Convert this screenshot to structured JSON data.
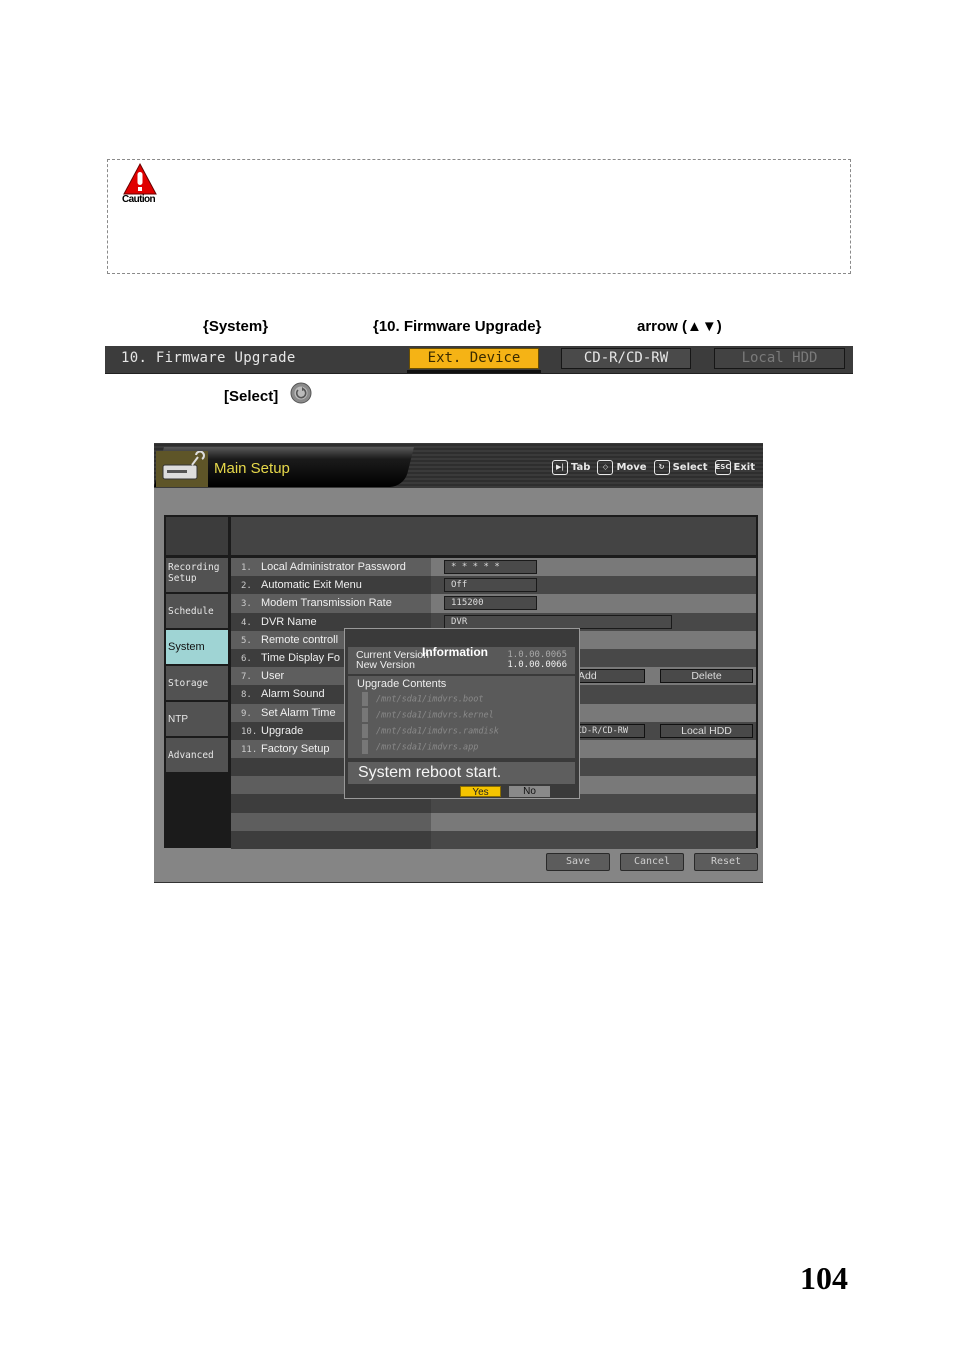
{
  "caution": {
    "label": "Caution",
    "icon": "warning-triangle-icon",
    "color": "#e00000"
  },
  "instruction": {
    "system": "{System}",
    "menu_item": "{10. Firmware Upgrade}",
    "arrow": "arrow (▲▼)",
    "select": "[Select]",
    "select_icon": "select-button-icon"
  },
  "firmware_bar": {
    "title": "10. Firmware Upgrade",
    "options": [
      {
        "label": "Ext. Device",
        "state": "active"
      },
      {
        "label": "CD-R/CD-RW",
        "state": "normal"
      },
      {
        "label": "Local HDD",
        "state": "disabled"
      }
    ],
    "accent": "#f5b315"
  },
  "screen": {
    "header": {
      "title": "Main Setup",
      "hints": [
        {
          "icon": "tab-icon",
          "glyph": "▶|",
          "label": "Tab"
        },
        {
          "icon": "move-icon",
          "glyph": "◇",
          "label": "Move"
        },
        {
          "icon": "select-icon",
          "glyph": "↻",
          "label": "Select"
        },
        {
          "icon": "esc-icon",
          "glyph": "ESC",
          "label": "Exit"
        }
      ]
    },
    "sidebar": [
      {
        "label": "Recording Setup",
        "selected": false
      },
      {
        "label": "Schedule",
        "selected": false
      },
      {
        "label": "System",
        "selected": true
      },
      {
        "label": "Storage",
        "selected": false
      },
      {
        "label": "NTP",
        "selected": false
      },
      {
        "label": "Advanced",
        "selected": false
      }
    ],
    "rows": [
      {
        "num": "1.",
        "label": "Local Administrator Password",
        "value": "* * * * *"
      },
      {
        "num": "2.",
        "label": "Automatic Exit Menu",
        "value": "Off"
      },
      {
        "num": "3.",
        "label": "Modem Transmission Rate",
        "value": "115200"
      },
      {
        "num": "4.",
        "label": "DVR Name",
        "value": "DVR"
      },
      {
        "num": "5.",
        "label": "Remote controll",
        "value": ""
      },
      {
        "num": "6.",
        "label": "Time Display Fo",
        "value": ""
      },
      {
        "num": "7.",
        "label": "User",
        "buttons": [
          "Add",
          "Delete"
        ]
      },
      {
        "num": "8.",
        "label": "Alarm Sound",
        "value": ""
      },
      {
        "num": "9.",
        "label": "Set Alarm Time",
        "value": ""
      },
      {
        "num": "10.",
        "label": "Upgrade",
        "buttons": [
          "CD-R/CD-RW",
          "Local HDD"
        ]
      },
      {
        "num": "11.",
        "label": "Factory Setup",
        "value": ""
      }
    ],
    "footer": {
      "save": "Save",
      "cancel": "Cancel",
      "reset": "Reset"
    },
    "dialog": {
      "title": "Information",
      "current_version_label": "Current Version",
      "current_version": "1.0.00.0065",
      "new_version_label": "New Version",
      "new_version": "1.0.00.0066",
      "upgrade_contents_label": "Upgrade Contents",
      "contents": [
        "/mnt/sda1/imdvrs.boot",
        "/mnt/sda1/imdvrs.kernel",
        "/mnt/sda1/imdvrs.ramdisk",
        "/mnt/sda1/imdvrs.app"
      ],
      "message": "System reboot start.",
      "yes": "Yes",
      "no": "No"
    }
  },
  "page_number": "104"
}
